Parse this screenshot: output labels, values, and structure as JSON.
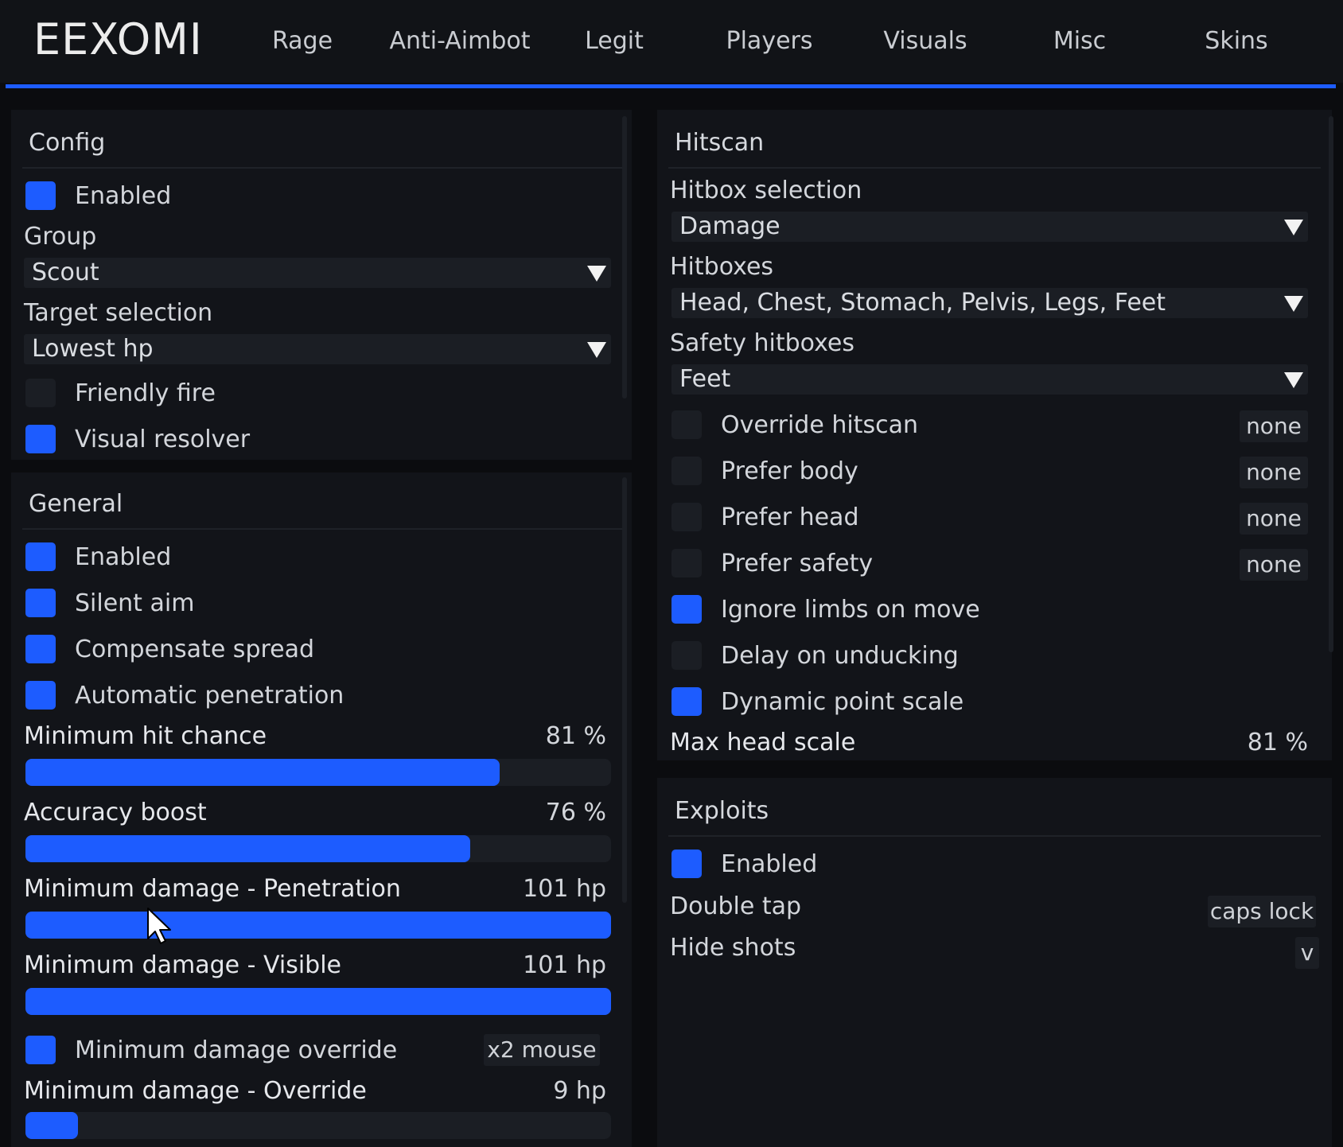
{
  "app": {
    "logo": "EEXOMI"
  },
  "tabs": [
    "Rage",
    "Anti-Aimbot",
    "Legit",
    "Players",
    "Visuals",
    "Misc",
    "Skins"
  ],
  "config": {
    "title": "Config",
    "enabled": {
      "label": "Enabled",
      "checked": true
    },
    "group": {
      "label": "Group",
      "value": "Scout"
    },
    "target_selection": {
      "label": "Target selection",
      "value": "Lowest hp"
    },
    "friendly_fire": {
      "label": "Friendly fire",
      "checked": false
    },
    "visual_resolver": {
      "label": "Visual resolver",
      "checked": true
    }
  },
  "general": {
    "title": "General",
    "checks": [
      {
        "label": "Enabled",
        "checked": true
      },
      {
        "label": "Silent aim",
        "checked": true
      },
      {
        "label": "Compensate spread",
        "checked": true
      },
      {
        "label": "Automatic penetration",
        "checked": true
      }
    ],
    "sliders": [
      {
        "label": "Minimum hit chance",
        "value_text": "81 %",
        "fill": 0.81
      },
      {
        "label": "Accuracy boost",
        "value_text": "76 %",
        "fill": 0.76
      },
      {
        "label": "Minimum damage - Penetration",
        "value_text": "101 hp",
        "fill": 1.0
      },
      {
        "label": "Minimum damage - Visible",
        "value_text": "101 hp",
        "fill": 1.0
      }
    ],
    "min_damage_override": {
      "label": "Minimum damage override",
      "checked": true,
      "key": "x2 mouse"
    },
    "override_slider": {
      "label": "Minimum damage - Override",
      "value_text": "9 hp",
      "fill": 0.09
    }
  },
  "hitscan": {
    "title": "Hitscan",
    "hitbox_selection": {
      "label": "Hitbox selection",
      "value": "Damage"
    },
    "hitboxes": {
      "label": "Hitboxes",
      "value": "Head, Chest, Stomach, Pelvis, Legs, Feet"
    },
    "safety_hitboxes": {
      "label": "Safety hitboxes",
      "value": "Feet"
    },
    "checks": [
      {
        "label": "Override hitscan",
        "checked": false,
        "key": "none"
      },
      {
        "label": "Prefer body",
        "checked": false,
        "key": "none"
      },
      {
        "label": "Prefer head",
        "checked": false,
        "key": "none"
      },
      {
        "label": "Prefer safety",
        "checked": false,
        "key": "none"
      },
      {
        "label": "Ignore limbs on move",
        "checked": true
      },
      {
        "label": "Delay on unducking",
        "checked": false
      },
      {
        "label": "Dynamic point scale",
        "checked": true
      }
    ],
    "max_head_scale": {
      "label": "Max head scale",
      "value_text": "81 %"
    }
  },
  "exploits": {
    "title": "Exploits",
    "enabled": {
      "label": "Enabled",
      "checked": true
    },
    "double_tap": {
      "label": "Double tap",
      "key": "caps lock"
    },
    "hide_shots": {
      "label": "Hide shots",
      "key": "v"
    }
  },
  "colors": {
    "accent": "#1d5cff",
    "background": "#0b0c0f",
    "panel": "#121419"
  }
}
